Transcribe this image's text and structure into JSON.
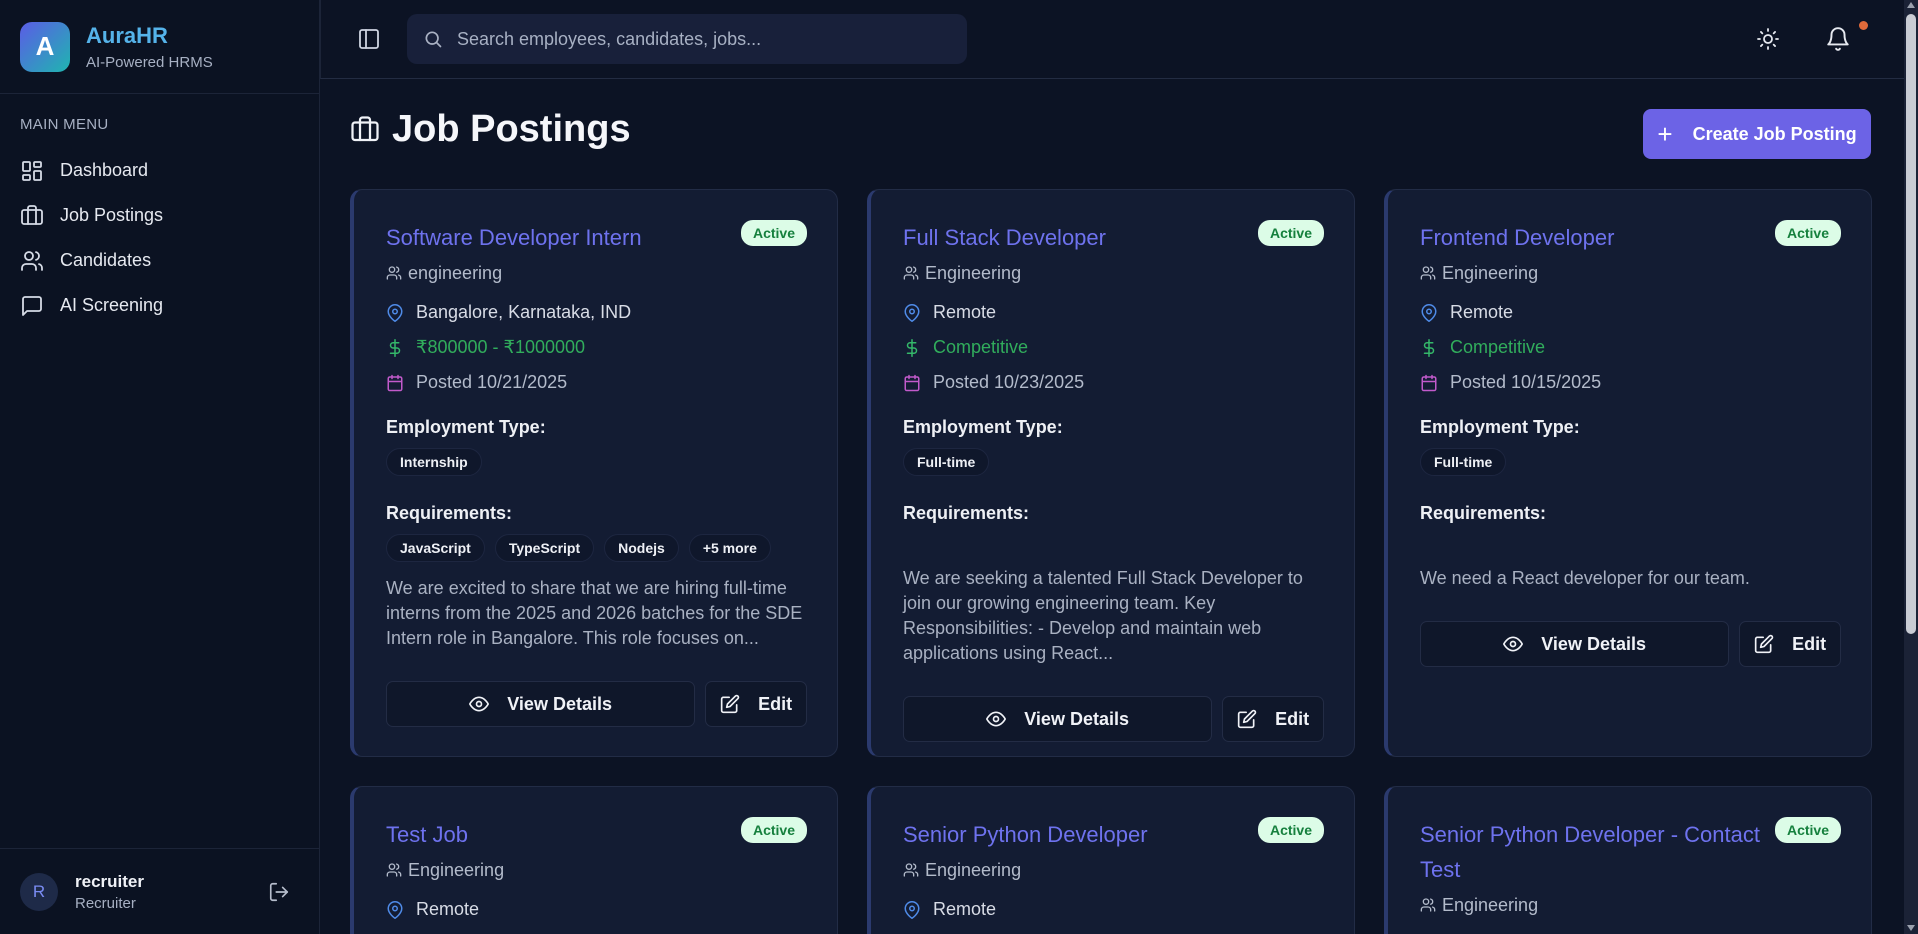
{
  "brand": {
    "logo_letter": "A",
    "name": "AuraHR",
    "subtitle": "AI-Powered HRMS"
  },
  "sidebar": {
    "menu_title": "MAIN MENU",
    "items": [
      {
        "label": "Dashboard",
        "icon": "dashboard-icon"
      },
      {
        "label": "Job Postings",
        "icon": "briefcase-icon"
      },
      {
        "label": "Candidates",
        "icon": "users-icon"
      },
      {
        "label": "AI Screening",
        "icon": "message-square-icon"
      }
    ],
    "user": {
      "initial": "R",
      "name": "recruiter",
      "role": "Recruiter"
    }
  },
  "topbar": {
    "search_placeholder": "Search employees, candidates, jobs..."
  },
  "page": {
    "title": "Job Postings",
    "create_button": "Create Job Posting",
    "create_icon": "+"
  },
  "labels": {
    "employment_type": "Employment Type:",
    "requirements": "Requirements:",
    "view_details": "View Details",
    "edit": "Edit"
  },
  "jobs": [
    {
      "title": "Software Developer Intern",
      "status": "Active",
      "department": "engineering",
      "location": "Bangalore, Karnataka, IND",
      "salary": "₹800000 - ₹1000000",
      "posted": "Posted 10/21/2025",
      "employment_type": "Internship",
      "requirements": [
        "JavaScript",
        "TypeScript",
        "Nodejs",
        "+5 more"
      ],
      "description": "We are excited to share that we are hiring full-time interns from the 2025 and 2026 batches for the SDE Intern role in Bangalore. This role focuses on..."
    },
    {
      "title": "Full Stack Developer",
      "status": "Active",
      "department": "Engineering",
      "location": "Remote",
      "salary": "Competitive",
      "posted": "Posted 10/23/2025",
      "employment_type": "Full-time",
      "requirements": [],
      "description": "We are seeking a talented Full Stack Developer to join our growing engineering team. Key Responsibilities: - Develop and maintain web applications using React..."
    },
    {
      "title": "Frontend Developer",
      "status": "Active",
      "department": "Engineering",
      "location": "Remote",
      "salary": "Competitive",
      "posted": "Posted 10/15/2025",
      "employment_type": "Full-time",
      "requirements": [],
      "description": "We need a React developer for our team."
    },
    {
      "title": "Test Job",
      "status": "Active",
      "department": "Engineering",
      "location": "Remote"
    },
    {
      "title": "Senior Python Developer",
      "status": "Active",
      "department": "Engineering",
      "location": "Remote"
    },
    {
      "title": "Senior Python Developer - Contact Test",
      "status": "Active",
      "department": "Engineering"
    }
  ],
  "colors": {
    "accent": "#6c63e6",
    "title_link": "#6e72ee",
    "badge_bg": "#dcfce7",
    "badge_text": "#15803d",
    "salary": "#31ad5c",
    "background": "#0c1324",
    "card": "#131c33"
  }
}
